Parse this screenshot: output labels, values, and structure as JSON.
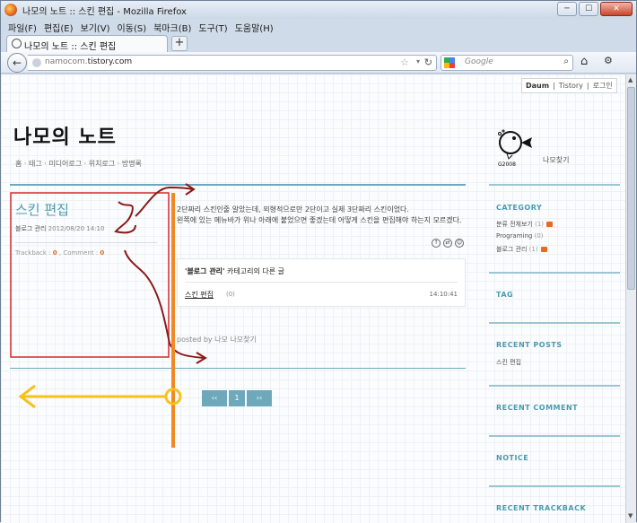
{
  "window": {
    "title": "나모의 노트 :: 스킨 편집 - Mozilla Firefox",
    "controls": {
      "minimize": "─",
      "maximize": "☐",
      "close": "✕"
    }
  },
  "menu": [
    "파일(F)",
    "편집(E)",
    "보기(V)",
    "이동(S)",
    "북마크(B)",
    "도구(T)",
    "도움말(H)"
  ],
  "tab": {
    "label": "나모의 노트 :: 스킨 편집",
    "new_tab": "+"
  },
  "nav": {
    "url_host_prefix": "namocom.",
    "url_host_main": "tistory.com",
    "search_placeholder": "Google"
  },
  "blog": {
    "toplinks": [
      "Daum",
      "Tistory",
      "로그인"
    ],
    "title": "나모의  노트",
    "nav": "홈  · 태그  · 미디어로그  · 위치로그  · 방명록"
  },
  "post": {
    "title": "스킨 편집",
    "category": "블로그 관리",
    "date": "2012/08/20 14:10",
    "trackback_label": "Trackback : ",
    "trackback_count": "0",
    "comment_label": " , Comment : ",
    "comment_count": "0",
    "body_1": "2단짜리 스킨인줄 알았는데, 외형적으로만 2단이고 실제 3단짜리 스킨이었다.",
    "body_2": "왼쪽에 있는 메뉴바가 위나 아래에 붙었으면 좋겠는데 어떻게 스킨을 편집해야 하는지 모르겠다.",
    "related_head_quote": "'블로그 관리'",
    "related_head_rest": " 카테고리의 다른 글",
    "related_title": "스킨 편집",
    "related_count": "(0)",
    "related_time": "14:10:41",
    "posted_by": "posted by 나모 나모찾기"
  },
  "pager": {
    "prev": "‹‹",
    "page": "1",
    "next": "››"
  },
  "sidebar": {
    "avatar_caption": "G2008",
    "owner_name": "나모찾기",
    "category_head": "CATEGORY",
    "categories": [
      {
        "name": "분류 전체보기",
        "count": "(1)",
        "new": true
      },
      {
        "name": "Programing",
        "count": "(0)",
        "new": false
      },
      {
        "name": "블로그 관리",
        "count": "(1)",
        "new": true
      }
    ],
    "tag_head": "TAG",
    "recent_posts_head": "RECENT POSTS",
    "recent_posts": [
      "스킨 편집"
    ],
    "recent_comment_head": "RECENT COMMENT",
    "notice_head": "NOTICE",
    "recent_trackback_head": "RECENT TRACKBACK"
  },
  "colors": {
    "accent": "#4b9bb0",
    "divider": "#6ea9bb",
    "badge": "#e86b1c",
    "annotation_red": "#d8262c",
    "annotation_dark_red": "#8b1a1a",
    "annotation_orange": "#f08a24",
    "annotation_yellow": "#f7c21b"
  },
  "icons": [
    "firefox-icon",
    "back-arrow-icon",
    "globe-icon",
    "star-icon",
    "reload-icon",
    "google-icon",
    "search-icon",
    "home-icon",
    "addon-icon",
    "share-icons"
  ]
}
